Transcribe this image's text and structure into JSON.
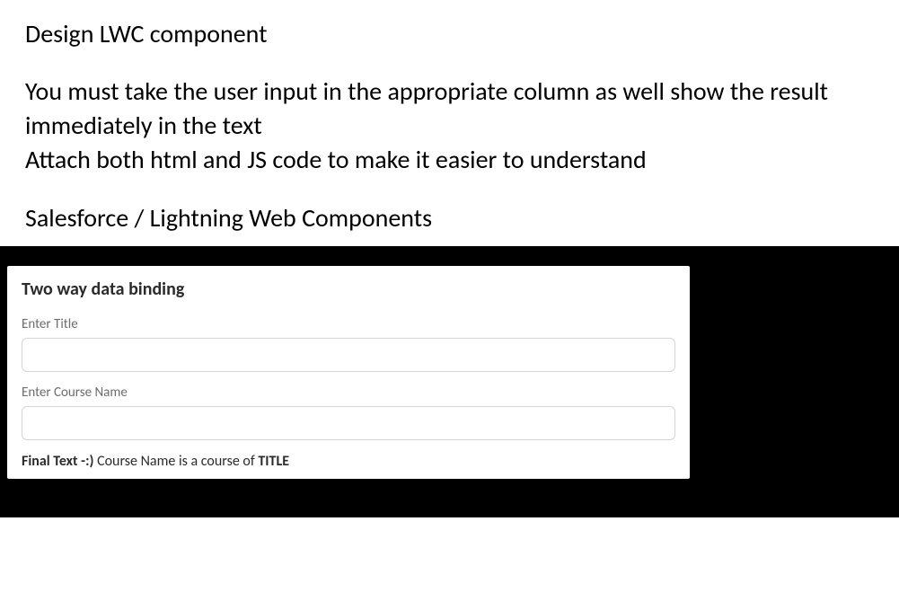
{
  "doc": {
    "heading": "Design LWC component",
    "line1": "You must take the user input in the appropriate column as well show the result immediately in the text",
    "line2": "Attach both html and JS code to make it easier to understand",
    "category": "Salesforce / Lightning Web Components"
  },
  "card": {
    "title": "Two way data binding",
    "titleField": {
      "label": "Enter Title",
      "value": ""
    },
    "courseField": {
      "label": "Enter Course Name",
      "value": ""
    },
    "final": {
      "lead": "Final Text -:)",
      "mid1": " Course Name is a course of ",
      "titleVal": "TITLE"
    }
  }
}
